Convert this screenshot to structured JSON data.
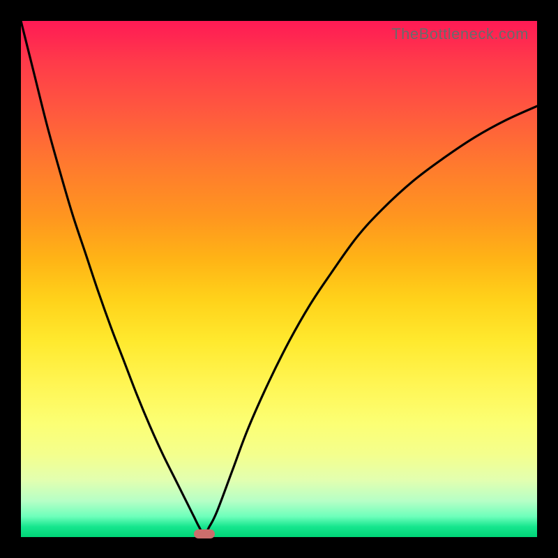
{
  "watermark": "TheBottleneck.com",
  "colors": {
    "frame": "#000000",
    "curve": "#000000",
    "marker": "#cc6e6c",
    "gradient_top": "#ff1a55",
    "gradient_bottom": "#00d577"
  },
  "chart_data": {
    "type": "line",
    "title": "",
    "xlabel": "",
    "ylabel": "",
    "xlim": [
      0,
      100
    ],
    "ylim": [
      0,
      100
    ],
    "grid": false,
    "legend": false,
    "annotations": {
      "marker_x": 35.5
    },
    "series": [
      {
        "name": "curve",
        "x": [
          0,
          2.5,
          5,
          7.5,
          10,
          12.5,
          15,
          17.5,
          20,
          22.5,
          25,
          27.5,
          30,
          32,
          33.5,
          34.5,
          35.5,
          36.5,
          38,
          41,
          44,
          48,
          52,
          56,
          60,
          65,
          70,
          76,
          82,
          88,
          94,
          100
        ],
        "y": [
          100,
          90,
          80,
          71,
          62.5,
          55,
          47.5,
          40.5,
          34,
          27.5,
          21.5,
          16,
          11,
          7,
          4,
          2,
          0.5,
          2,
          5,
          13,
          21,
          30,
          38,
          45,
          51,
          58,
          63.5,
          69,
          73.5,
          77.5,
          80.8,
          83.5
        ]
      }
    ]
  }
}
